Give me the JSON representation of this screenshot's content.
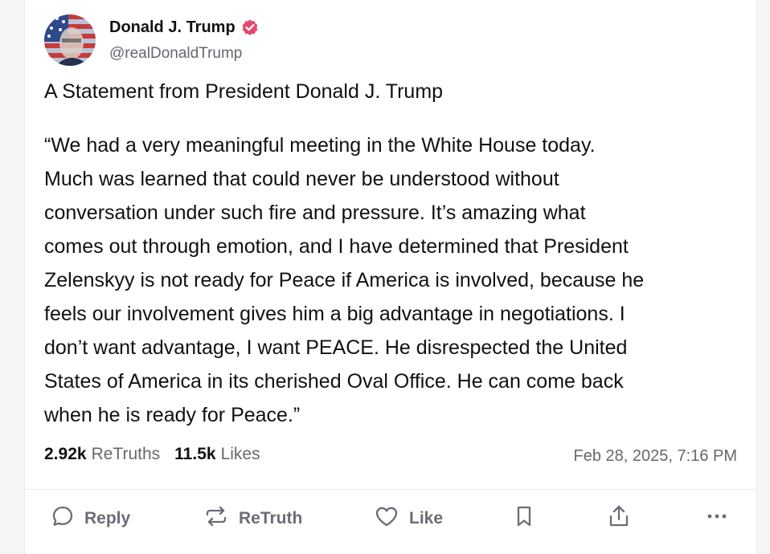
{
  "post": {
    "display_name": "Donald J. Trump",
    "handle": "@realDonaldTrump",
    "verified": true,
    "intro": "A Statement from President Donald J. Trump",
    "quote_lines": [
      "“We had a very meaningful meeting in the White House today.",
      "Much was learned that could never be understood without",
      "conversation under such fire and pressure. It’s amazing what",
      "comes out through emotion, and I have determined that President",
      "Zelenskyy is not ready for Peace if America is involved, because he",
      "feels our involvement gives him a big advantage in negotiations. I",
      "don’t want advantage, I want PEACE. He disrespected the United",
      "States of America in its cherished Oval Office. He can come back",
      "when he is ready for Peace.”"
    ],
    "retruths_count": "2.92k",
    "retruths_label": "ReTruths",
    "likes_count": "11.5k",
    "likes_label": "Likes",
    "timestamp": "Feb 28, 2025, 7:16 PM"
  },
  "actions": {
    "reply_label": "Reply",
    "retruth_label": "ReTruth",
    "like_label": "Like"
  },
  "icons": {
    "verified": "verified-badge-icon",
    "reply": "reply-icon",
    "retruth": "retruth-icon",
    "like": "heart-icon",
    "bookmark": "bookmark-icon",
    "share": "share-icon",
    "more": "more-icon"
  },
  "colors": {
    "verified_badge": "#e7476b",
    "text_primary": "#111111",
    "text_secondary": "#666870",
    "action_gray": "#6b6d76"
  }
}
